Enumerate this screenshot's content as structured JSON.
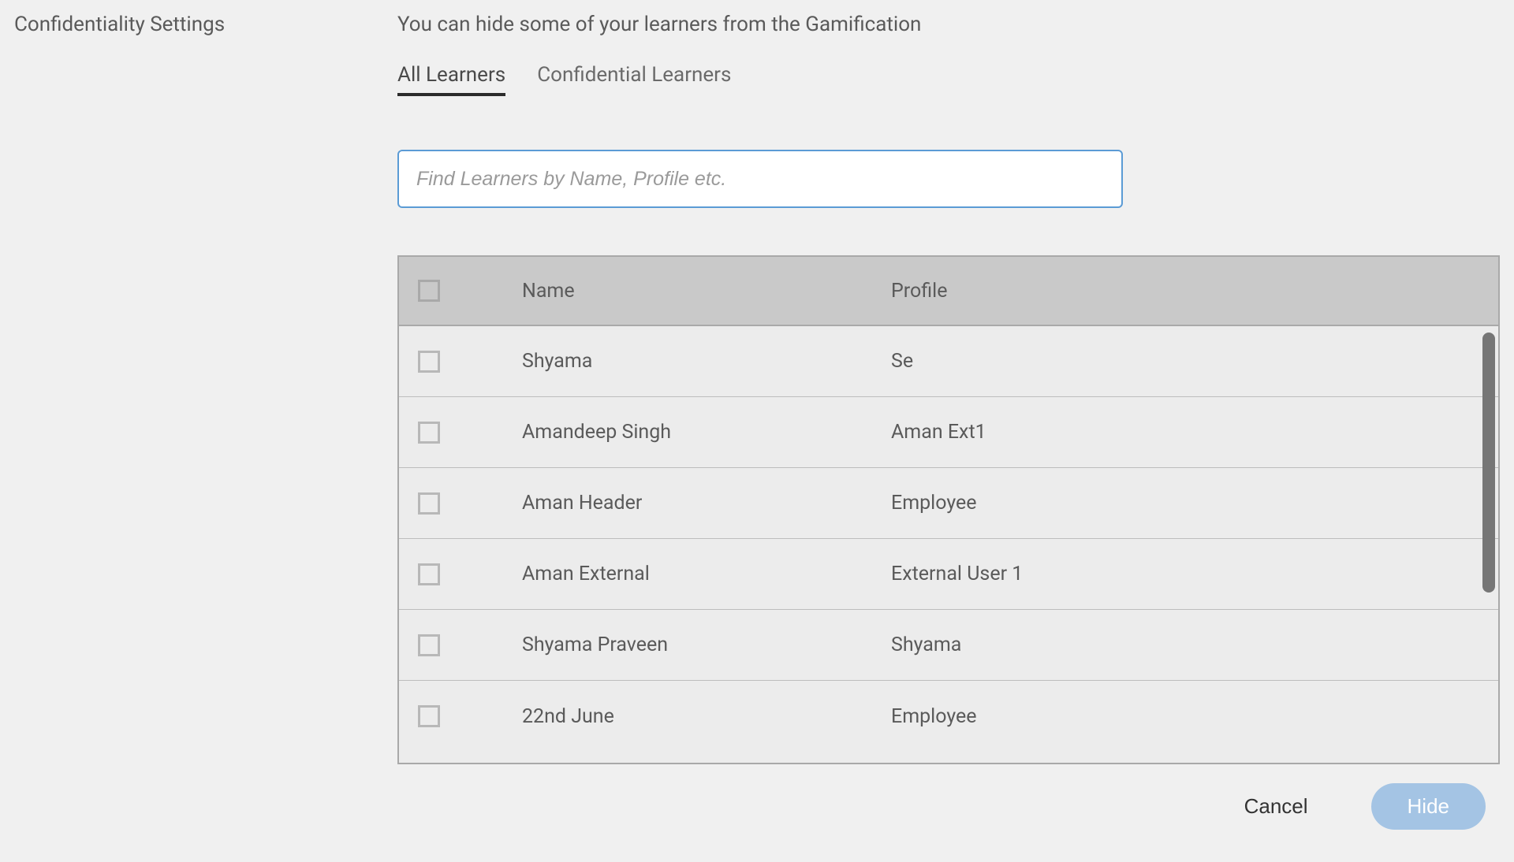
{
  "section_title": "Confidentiality Settings",
  "description": "You can hide some of your learners from the Gamification",
  "tabs": {
    "all": "All Learners",
    "confidential": "Confidential Learners"
  },
  "search": {
    "placeholder": "Find Learners by Name, Profile etc.",
    "value": ""
  },
  "table": {
    "headers": {
      "name": "Name",
      "profile": "Profile"
    },
    "rows": [
      {
        "name": "Shyama",
        "profile": "Se"
      },
      {
        "name": "Amandeep Singh",
        "profile": "Aman Ext1"
      },
      {
        "name": "Aman Header",
        "profile": "Employee"
      },
      {
        "name": "Aman External",
        "profile": "External User 1"
      },
      {
        "name": "Shyama Praveen",
        "profile": "Shyama"
      },
      {
        "name": "22nd June",
        "profile": "Employee"
      }
    ]
  },
  "buttons": {
    "cancel": "Cancel",
    "hide": "Hide"
  }
}
